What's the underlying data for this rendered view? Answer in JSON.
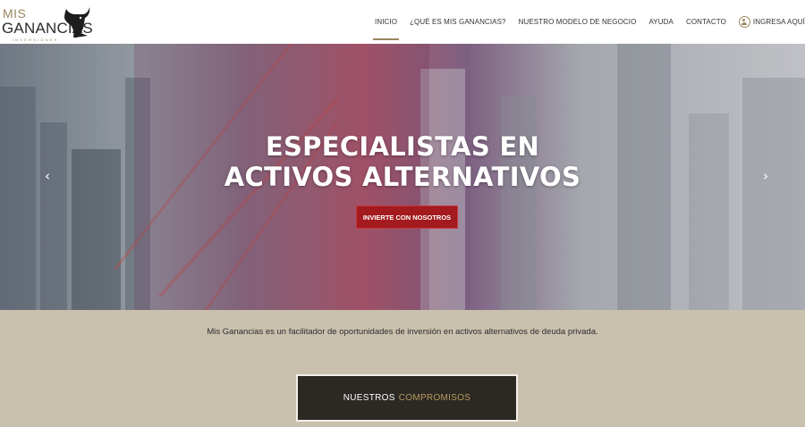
{
  "brand": {
    "line1": "MIS",
    "line2": "GANANCIAS",
    "subline": "INVERSIONES",
    "accent_color": "#9a8660"
  },
  "nav": {
    "items": [
      {
        "label": "INICIO",
        "active": true
      },
      {
        "label": "¿QUÉ ES MIS GANANCIAS?",
        "active": false
      },
      {
        "label": "NUESTRO MODELO DE NEGOCIO",
        "active": false
      },
      {
        "label": "AYUDA",
        "active": false
      },
      {
        "label": "CONTACTO",
        "active": false
      }
    ],
    "login_label": "INGRESA AQUÍ",
    "login_icon": "user-circle-icon"
  },
  "hero": {
    "title_line1": "ESPECIALISTAS EN",
    "title_line2": "ACTIVOS ALTERNATIVOS",
    "cta_label": "INVIERTE CON NOSOTROS",
    "cta_color": "#a31a1f",
    "prev_icon": "chevron-left-icon",
    "next_icon": "chevron-right-icon"
  },
  "intro": {
    "text": "Mis Ganancias es un facilitador de oportunidades de inversión en activos alternativos de deuda privada."
  },
  "commitments": {
    "label_white": "NUESTROS",
    "label_gold": "COMPROMISOS"
  }
}
